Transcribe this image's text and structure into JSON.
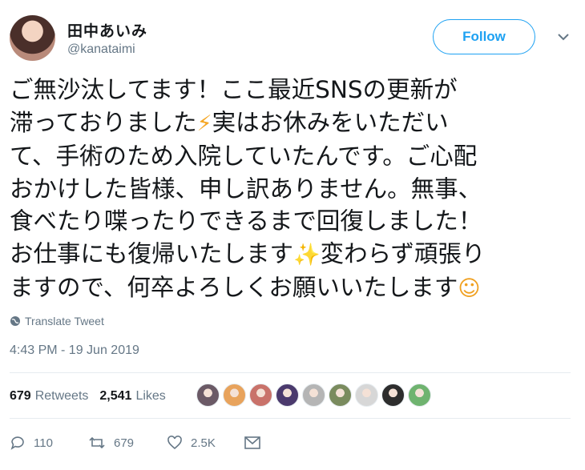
{
  "user": {
    "name": "田中あいみ",
    "handle": "@kanataimi"
  },
  "follow_label": "Follow",
  "tweet": {
    "lines": [
      "ご無沙汰してます！ここ最近SNSの更新が",
      "滞っておりました",
      "実はお休みをいただい",
      "て、手術のため入院していたんです。ご心配",
      "おかけした皆様、申し訳ありません。無事、",
      "食べたり喋ったりできるまで回復しました！",
      "お仕事にも復帰いたします",
      "変わらず頑張り",
      "ますので、何卒よろしくお願いいたします"
    ],
    "emojis": {
      "lightning": "⚡",
      "sparkles": "✨",
      "smile": "☺"
    }
  },
  "translate_label": "Translate Tweet",
  "timestamp": "4:43 PM - 19 Jun 2019",
  "stats": {
    "retweets_count": "679",
    "retweets_label": "Retweets",
    "likes_count": "2,541",
    "likes_label": "Likes"
  },
  "liker_avatars": [
    "#6b5a66",
    "#e8a35c",
    "#c9726a",
    "#4b3a6d",
    "#b5b5b5",
    "#7a8b5e",
    "#d7d7d7",
    "#2d2d2d",
    "#6fb36f"
  ],
  "actions": {
    "replies": "110",
    "retweets": "679",
    "likes": "2.5K"
  },
  "colors": {
    "accent": "#1da1f2",
    "muted": "#657786"
  }
}
